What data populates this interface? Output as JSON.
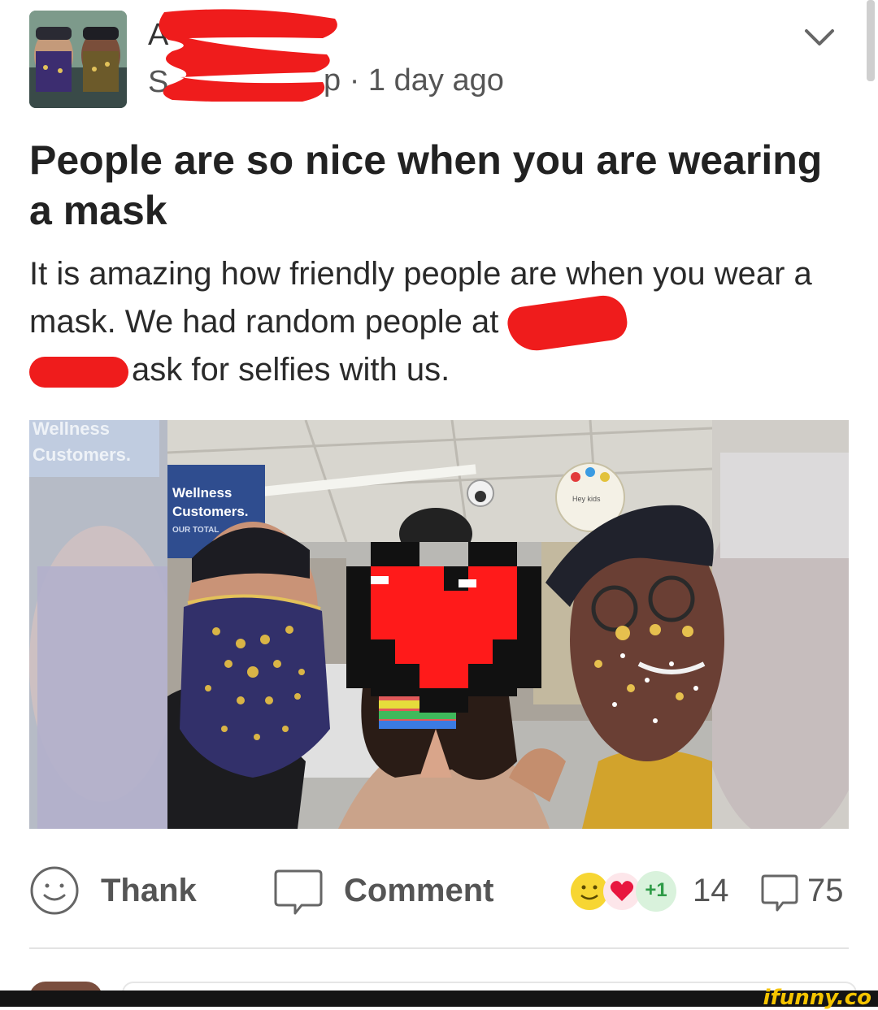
{
  "post": {
    "author_initial": "A",
    "subline_prefix": "S",
    "subline_suffix": "p",
    "time": "1 day ago",
    "title": "People are so nice when you are wearing a mask",
    "body_part1": "It is amazing how friendly people are when you wear a mask. We had random people at",
    "body_part2": "ask for selfies with us."
  },
  "photo": {
    "store_sign": [
      "Wellness",
      "Customers."
    ],
    "store_sign_small": "OUR TOTAL",
    "ceiling_sign": "Hey kids"
  },
  "actions": {
    "thank_label": "Thank",
    "comment_label": "Comment",
    "reaction_plus": "+1",
    "reaction_count": "14",
    "comment_count": "75"
  },
  "footer": {
    "brand": "ifunny.co"
  },
  "icons": {
    "chevron": "chevron-down-icon",
    "thank": "smiley-icon",
    "comment": "speech-bubble-icon"
  },
  "colors": {
    "redaction": "#ef1c1c",
    "heart_censor": "#ff1a1a",
    "brand": "#f5c400",
    "reaction_green": "#4caf50"
  }
}
